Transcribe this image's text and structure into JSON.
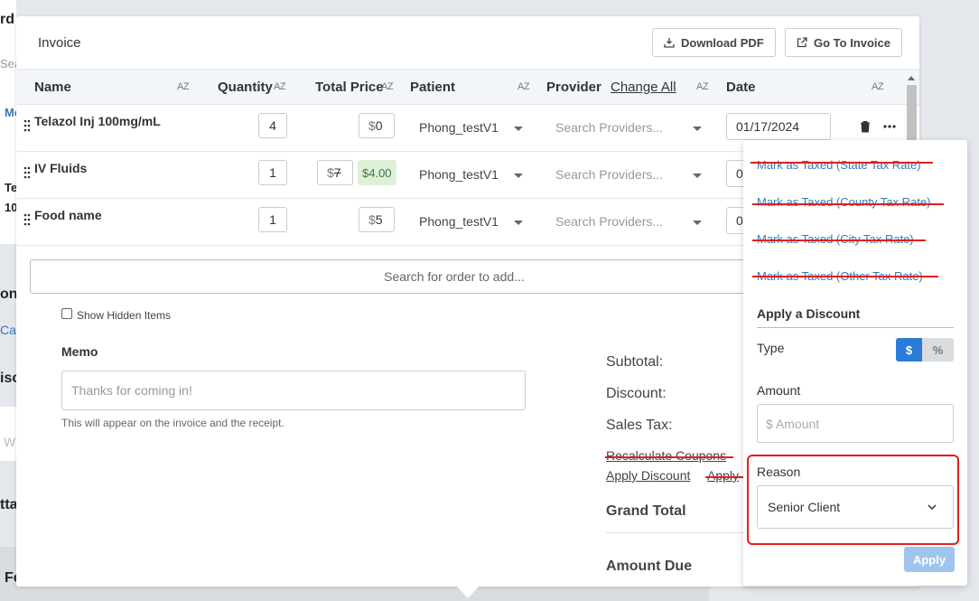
{
  "background": {
    "fragments": [
      "rd",
      "Sea",
      "Me",
      "Te",
      "10",
      "on",
      "Cap",
      "isc",
      "W",
      "tta",
      "Fo"
    ]
  },
  "modal": {
    "title": "Invoice",
    "download_pdf_label": "Download PDF",
    "go_to_invoice_label": "Go To Invoice",
    "columns": {
      "name": "Name",
      "quantity": "Quantity",
      "total_price": "Total Price",
      "patient": "Patient",
      "provider": "Provider",
      "change_all": "Change All",
      "date": "Date",
      "sort_icon": "AZ"
    },
    "rows": [
      {
        "name": "Telazol Inj 100mg/mL",
        "quantity": "4",
        "currency": "$",
        "price": "0",
        "patient": "Phong_testV1",
        "provider_placeholder": "Search Providers...",
        "date": "01/17/2024"
      },
      {
        "name": "IV Fluids",
        "quantity": "1",
        "currency": "$",
        "price": "7",
        "computed": "$4.00",
        "patient": "Phong_testV1",
        "provider_placeholder": "Search Providers...",
        "date": "0"
      },
      {
        "name": "Food name",
        "quantity": "1",
        "currency": "$",
        "price": "5",
        "patient": "Phong_testV1",
        "provider_placeholder": "Search Providers...",
        "date": "0"
      }
    ],
    "search_order_placeholder": "Search for order to add...",
    "show_hidden_items": "Show Hidden Items",
    "memo_label": "Memo",
    "memo_placeholder": "Thanks for coming in!",
    "memo_help": "This will appear on the invoice and the receipt.",
    "totals": {
      "subtotal": "Subtotal:",
      "discount": "Discount:",
      "sales_tax": "Sales Tax:",
      "recalculate_coupons": "Recalculate Coupons",
      "apply_discount": "Apply Discount",
      "apply_partial": "Apply",
      "grand_total": "Grand Total",
      "amount_due": "Amount Due"
    }
  },
  "popover": {
    "items": [
      "Mark as Taxed (State Tax Rate)",
      "Mark as Taxed (County Tax Rate)",
      "Mark as Taxed (City Tax Rate)",
      "Mark as Taxed (Other Tax Rate)"
    ],
    "section_title": "Apply a Discount",
    "type_label": "Type",
    "type_dollar": "$",
    "type_percent": "%",
    "amount_label": "Amount",
    "amount_placeholder": "$ Amount",
    "reason_label": "Reason",
    "reason_value": "Senior Client",
    "apply_label": "Apply"
  },
  "colors": {
    "accent": "#2b7bd8",
    "link": "#337ab7",
    "strike": "#e02020",
    "success_bg": "#dff0d8"
  }
}
